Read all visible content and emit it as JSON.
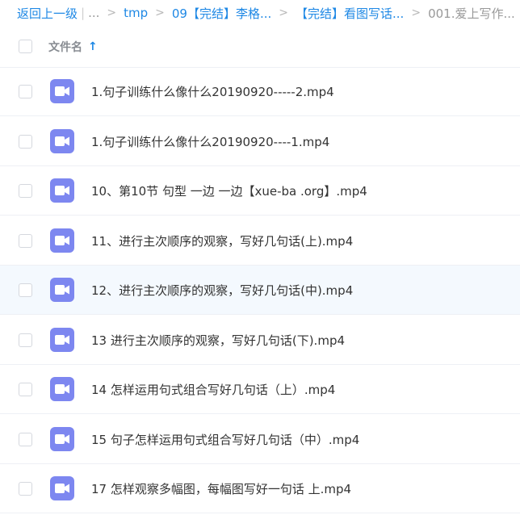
{
  "breadcrumb": {
    "back_label": "返回上一级",
    "bar": "|",
    "ellipsis": "...",
    "sep": ">",
    "items": [
      "tmp",
      "09【完结】李格...",
      "【完结】看图写话...",
      "001.爱上写作..."
    ]
  },
  "header": {
    "column_title": "文件名",
    "sort_icon": "arrow-up-icon"
  },
  "files": [
    {
      "name": "1.句子训练什么像什么20190920-----2.mp4"
    },
    {
      "name": "1.句子训练什么像什么20190920----1.mp4"
    },
    {
      "name": "10、第10节 句型 一边 一边【xue-ba .org】.mp4"
    },
    {
      "name": "11、进行主次顺序的观察，写好几句话(上).mp4"
    },
    {
      "name": "12、进行主次顺序的观察，写好几句话(中).mp4"
    },
    {
      "name": "13 进行主次顺序的观察，写好几句话(下).mp4"
    },
    {
      "name": "14 怎样运用句式组合写好几句话（上）.mp4"
    },
    {
      "name": "15 句子怎样运用句式组合写好几句话（中）.mp4"
    },
    {
      "name": "17 怎样观察多幅图，每幅图写好一句话 上.mp4"
    }
  ],
  "colors": {
    "accent": "#1e88e5",
    "video_icon_bg": "#7d87f0",
    "hover_row_bg": "#f4f9fe"
  }
}
